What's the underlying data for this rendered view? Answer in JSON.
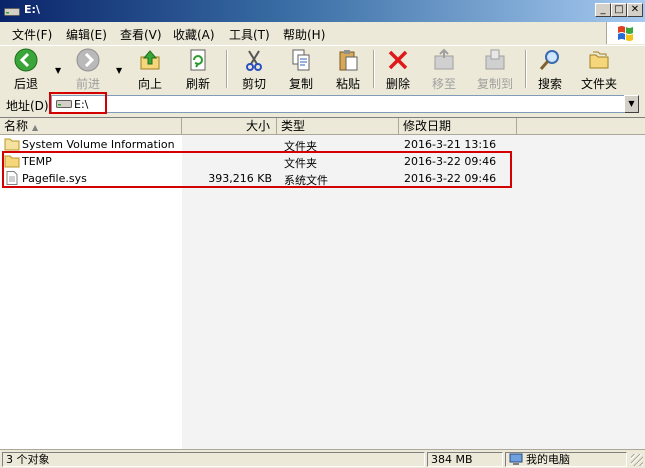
{
  "window": {
    "title": "E:\\"
  },
  "title_buttons": {
    "minimize": "_",
    "maximize": "□",
    "close": "✕"
  },
  "menu": [
    "文件(F)",
    "编辑(E)",
    "查看(V)",
    "收藏(A)",
    "工具(T)",
    "帮助(H)"
  ],
  "toolbar": {
    "back": "后退",
    "forward": "前进",
    "up": "向上",
    "refresh": "刷新",
    "cut": "剪切",
    "copy": "复制",
    "paste": "粘贴",
    "delete": "删除",
    "move_to": "移至",
    "copy_to": "复制到",
    "search": "搜索",
    "folders": "文件夹"
  },
  "address": {
    "label": "地址(D)",
    "value": "E:\\"
  },
  "columns": {
    "name": "名称",
    "size": "大小",
    "type": "类型",
    "modified": "修改日期"
  },
  "files": [
    {
      "name": "System Volume Information",
      "size": "",
      "type": "文件夹",
      "modified": "2016-3-21 13:16"
    },
    {
      "name": "TEMP",
      "size": "",
      "type": "文件夹",
      "modified": "2016-3-22 09:46"
    },
    {
      "name": "Pagefile.sys",
      "size": "393,216 KB",
      "type": "系统文件",
      "modified": "2016-3-22 09:46"
    }
  ],
  "status": {
    "objects": "3 个对象",
    "size": "384 MB",
    "location": "我的电脑"
  },
  "colors": {
    "highlight": "#d40000",
    "titlebar": "#0a246a",
    "folder": "#f5d67a"
  }
}
